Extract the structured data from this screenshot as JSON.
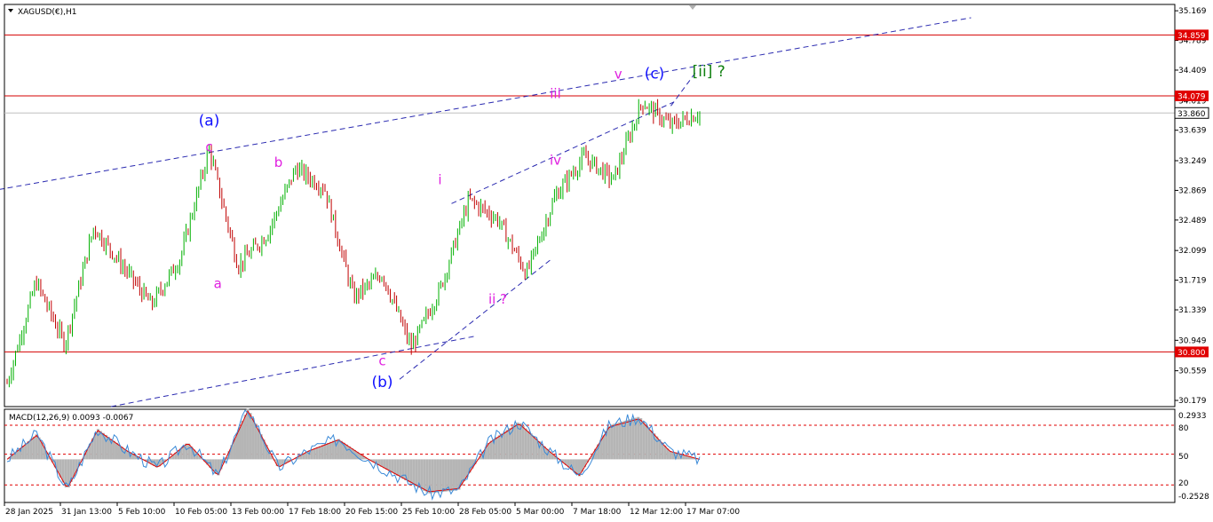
{
  "symbol_label": "XAGUSD(€),H1",
  "colors": {
    "up_candle": "#00b000",
    "down_candle": "#c00000",
    "level_line": "#d40000",
    "trend_line": "#2a2ab0",
    "wave_magenta": "#e020e0",
    "wave_blue": "#1010ff",
    "wave_green": "#108010",
    "macd_hist": "#b5b5b5",
    "macd_signal": "#e00000",
    "macd_main": "#3a8ad8",
    "price_tag_bg": "#e00000",
    "current_tag_bg": "#ffffff"
  },
  "price_axis_ticks": [
    "35.169",
    "34.789",
    "34.409",
    "34.019",
    "33.639",
    "33.249",
    "32.869",
    "32.489",
    "32.099",
    "31.719",
    "31.339",
    "30.949",
    "30.559",
    "30.179"
  ],
  "level_tags": [
    {
      "value": "34.859"
    },
    {
      "value": "34.079"
    },
    {
      "value": "30.800"
    }
  ],
  "current_price": "33.860",
  "time_axis_ticks": [
    "28 Jan 2025",
    "31 Jan 13:00",
    "5 Feb 10:00",
    "10 Feb 05:00",
    "13 Feb 00:00",
    "17 Feb 18:00",
    "20 Feb 15:00",
    "25 Feb 10:00",
    "28 Feb 05:00",
    "5 Mar 00:00",
    "7 Mar 18:00",
    "12 Mar 12:00",
    "17 Mar 07:00"
  ],
  "wave_labels": [
    {
      "text": "(a)",
      "color": "blue"
    },
    {
      "text": "c",
      "color": "magenta"
    },
    {
      "text": "a",
      "color": "magenta"
    },
    {
      "text": "b",
      "color": "magenta"
    },
    {
      "text": "c",
      "color": "magenta"
    },
    {
      "text": "(b)",
      "color": "blue"
    },
    {
      "text": "i",
      "color": "magenta"
    },
    {
      "text": "ii ?",
      "color": "magenta"
    },
    {
      "text": "iii",
      "color": "magenta"
    },
    {
      "text": "iv",
      "color": "magenta"
    },
    {
      "text": "v",
      "color": "magenta"
    },
    {
      "text": "(c)",
      "color": "blue"
    },
    {
      "text": "[ii] ?",
      "color": "green"
    }
  ],
  "macd": {
    "label": "MACD(12,26,9) 0.0093 -0.0067",
    "axis_ticks": [
      "0.2933",
      "80",
      "50",
      "20",
      "-0.2528"
    ]
  },
  "chart_data": {
    "type": "candlestick",
    "ylim": [
      30.1,
      35.25
    ],
    "grid": false,
    "key_points": [
      {
        "t": "28 Jan",
        "price": 30.4
      },
      {
        "t": "30 Jan",
        "price": 31.7
      },
      {
        "t": "31 Jan",
        "price": 30.9
      },
      {
        "t": "4 Feb",
        "price": 32.4
      },
      {
        "t": "7 Feb",
        "price": 31.9
      },
      {
        "t": "10 Feb",
        "price": 31.4
      },
      {
        "t": "12 Feb",
        "price": 32.0
      },
      {
        "t": "13 Feb",
        "price": 33.4
      },
      {
        "t": "14 Feb",
        "price": 31.9
      },
      {
        "t": "17 Feb",
        "price": 32.3
      },
      {
        "t": "19 Feb",
        "price": 33.15
      },
      {
        "t": "20 Feb",
        "price": 32.9
      },
      {
        "t": "24 Feb",
        "price": 31.5
      },
      {
        "t": "26 Feb",
        "price": 31.8
      },
      {
        "t": "28 Feb",
        "price": 30.85
      },
      {
        "t": "3 Mar",
        "price": 31.6
      },
      {
        "t": "5 Mar",
        "price": 32.75
      },
      {
        "t": "6 Mar",
        "price": 32.5
      },
      {
        "t": "7 Mar",
        "price": 31.8
      },
      {
        "t": "10 Mar",
        "price": 32.8
      },
      {
        "t": "11 Mar",
        "price": 33.3
      },
      {
        "t": "12 Mar",
        "price": 33.0
      },
      {
        "t": "13 Mar",
        "price": 34.0
      },
      {
        "t": "14 Mar",
        "price": 33.7
      },
      {
        "t": "17 Mar",
        "price": 33.86
      }
    ],
    "horizontal_levels": [
      34.859,
      34.079,
      30.8
    ],
    "current_price": 33.86,
    "macd": {
      "ylim": [
        -0.2528,
        0.2933
      ],
      "level_lines": [
        0.2,
        0.03,
        -0.15
      ],
      "key_points": [
        0.0,
        0.15,
        -0.18,
        0.18,
        0.05,
        -0.05,
        0.1,
        -0.1,
        0.3,
        -0.05,
        0.05,
        0.12,
        0.0,
        -0.1,
        -0.2,
        -0.18,
        0.1,
        0.22,
        0.05,
        -0.1,
        0.2,
        0.25,
        0.05,
        0.0
      ]
    }
  }
}
